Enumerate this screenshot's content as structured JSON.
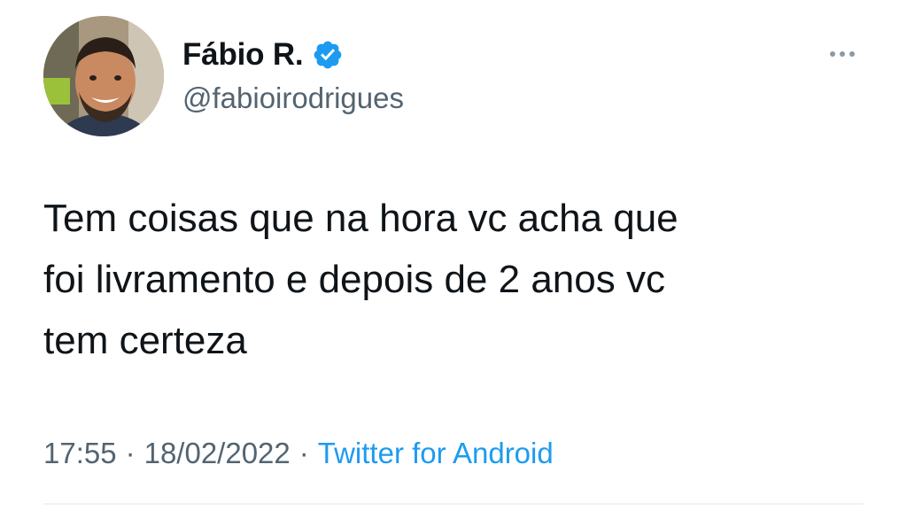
{
  "author": {
    "display_name": "Fábio R.",
    "handle": "@fabioirodrigues",
    "verified": true
  },
  "tweet": {
    "text": "Tem coisas que na hora vc acha que\nfoi livramento e depois de 2 anos vc\ntem certeza",
    "time": "17:55",
    "separator": "·",
    "date": "18/02/2022",
    "source": "Twitter for Android"
  },
  "icons": {
    "verified": "verified-badge-icon",
    "more": "more-options-icon"
  },
  "colors": {
    "text_primary": "#0f1419",
    "text_secondary": "#536471",
    "accent": "#1d9bf0"
  }
}
